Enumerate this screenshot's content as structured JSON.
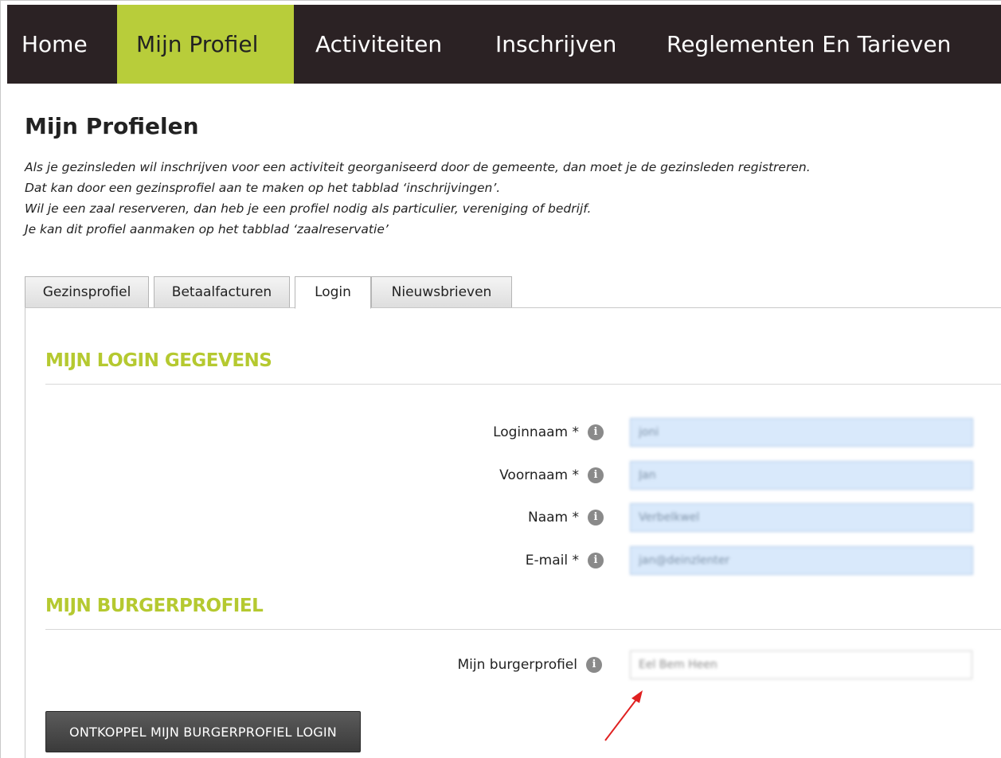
{
  "nav": {
    "items": [
      {
        "label": "Home"
      },
      {
        "label": "Mijn Profiel",
        "active": true
      },
      {
        "label": "Activiteiten"
      },
      {
        "label": "Inschrijven"
      },
      {
        "label": "Reglementen En Tarieven"
      }
    ],
    "active_color": "#b8cd3a",
    "background_color": "#2b2224"
  },
  "page": {
    "title": "Mijn Profielen",
    "intro": [
      "Als je gezinsleden wil inschrijven voor een activiteit georganiseerd door de gemeente, dan moet je de gezinsleden registreren.",
      "Dat kan door een gezinsprofiel aan te maken op het tabblad ‘inschrijvingen’.",
      "Wil je een zaal reserveren, dan heb je een profiel nodig als particulier, vereniging of bedrijf.",
      "Je kan dit profiel aanmaken op het tabblad ‘zaalreservatie’"
    ]
  },
  "tabs": [
    {
      "label": "Gezinsprofiel"
    },
    {
      "label": "Betaalfacturen"
    },
    {
      "label": "Login",
      "active": true
    },
    {
      "label": "Nieuwsbrieven"
    }
  ],
  "login_section": {
    "title": "MIJN LOGIN GEGEVENS",
    "fields": [
      {
        "label": "Loginnaam *",
        "value": "joni",
        "redacted": true
      },
      {
        "label": "Voornaam *",
        "value": "Jan",
        "redacted": true
      },
      {
        "label": "Naam *",
        "value": "Verbelkwel",
        "redacted": true
      },
      {
        "label": "E-mail *",
        "value": "jan@deinzlenter",
        "redacted": true
      }
    ]
  },
  "burger_section": {
    "title": "MIJN BURGERPROFIEL",
    "field": {
      "label": "Mijn burgerprofiel",
      "value": "Eel Bem Heen",
      "redacted": true
    },
    "button_label": "ONTKOPPEL MIJN BURGERPROFIEL LOGIN"
  },
  "icons": {
    "info": "info-icon",
    "arrow": "red-arrow-annotation"
  },
  "colors": {
    "section_title": "#b5c930",
    "input_background": "#d9e9fb",
    "arrow": "#e02020"
  }
}
